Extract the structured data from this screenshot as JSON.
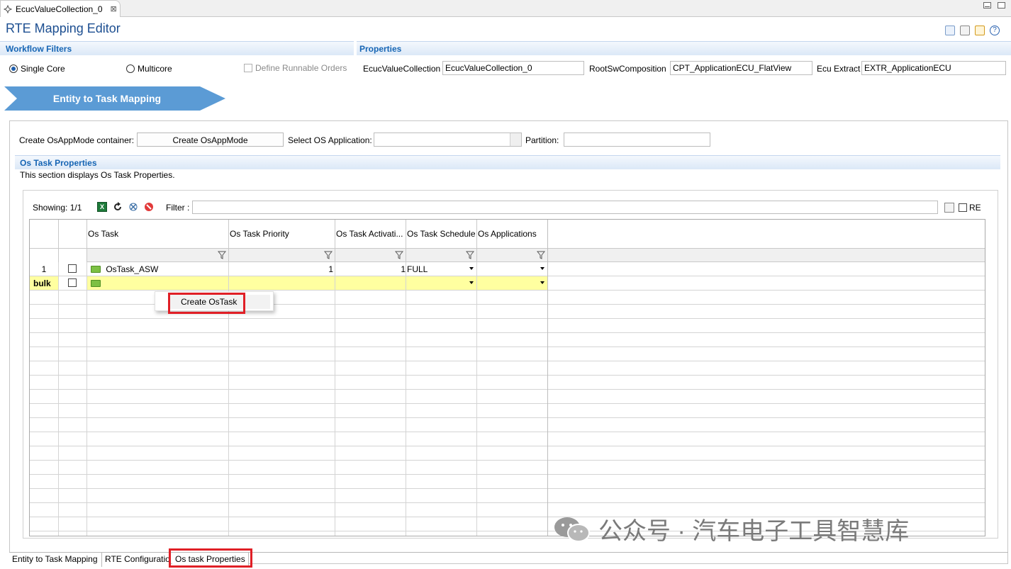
{
  "editor_tab": {
    "label": "EcucValueCollection_0",
    "close": "⊠"
  },
  "title": "RTE Mapping Editor",
  "workflow_filters": {
    "title": "Workflow Filters",
    "single_core": "Single Core",
    "multicore": "Multicore",
    "define_runnable_orders": "Define Runnable Orders"
  },
  "properties": {
    "title": "Properties",
    "ecuc_label": "EcucValueCollection",
    "ecuc_value": "EcucValueCollection_0",
    "root_label": "RootSwComposition",
    "root_value": "CPT_ApplicationECU_FlatView",
    "extract_label": "Ecu Extract",
    "extract_value": "EXTR_ApplicationECU"
  },
  "banner": {
    "label": "Entity to Task Mapping"
  },
  "controls": {
    "create_container_label": "Create OsAppMode container:",
    "create_button": "Create OsAppMode",
    "select_app_label": "Select OS Application:",
    "partition_label": "Partition:"
  },
  "os_section": {
    "title": "Os Task Properties",
    "description": "This section displays Os Task Properties."
  },
  "toolbar": {
    "showing": "Showing: 1/1",
    "filter_label": "Filter :",
    "re_label": "RE"
  },
  "table": {
    "columns": [
      "Os Task",
      "Os Task Priority",
      "Os Task Activati...",
      "Os Task Schedule",
      "Os Applications"
    ],
    "rows": [
      {
        "num": "1",
        "task": "OsTask_ASW",
        "priority": "1",
        "activation": "1",
        "schedule": "FULL",
        "apps": ""
      }
    ],
    "bulk_label": "bulk"
  },
  "context_menu": {
    "item": "Create OsTask"
  },
  "bottom_tabs": [
    "Entity to Task Mapping",
    "RTE Configuration",
    "Os task Properties"
  ],
  "watermark": "公众号 · 汽车电子工具智慧库"
}
